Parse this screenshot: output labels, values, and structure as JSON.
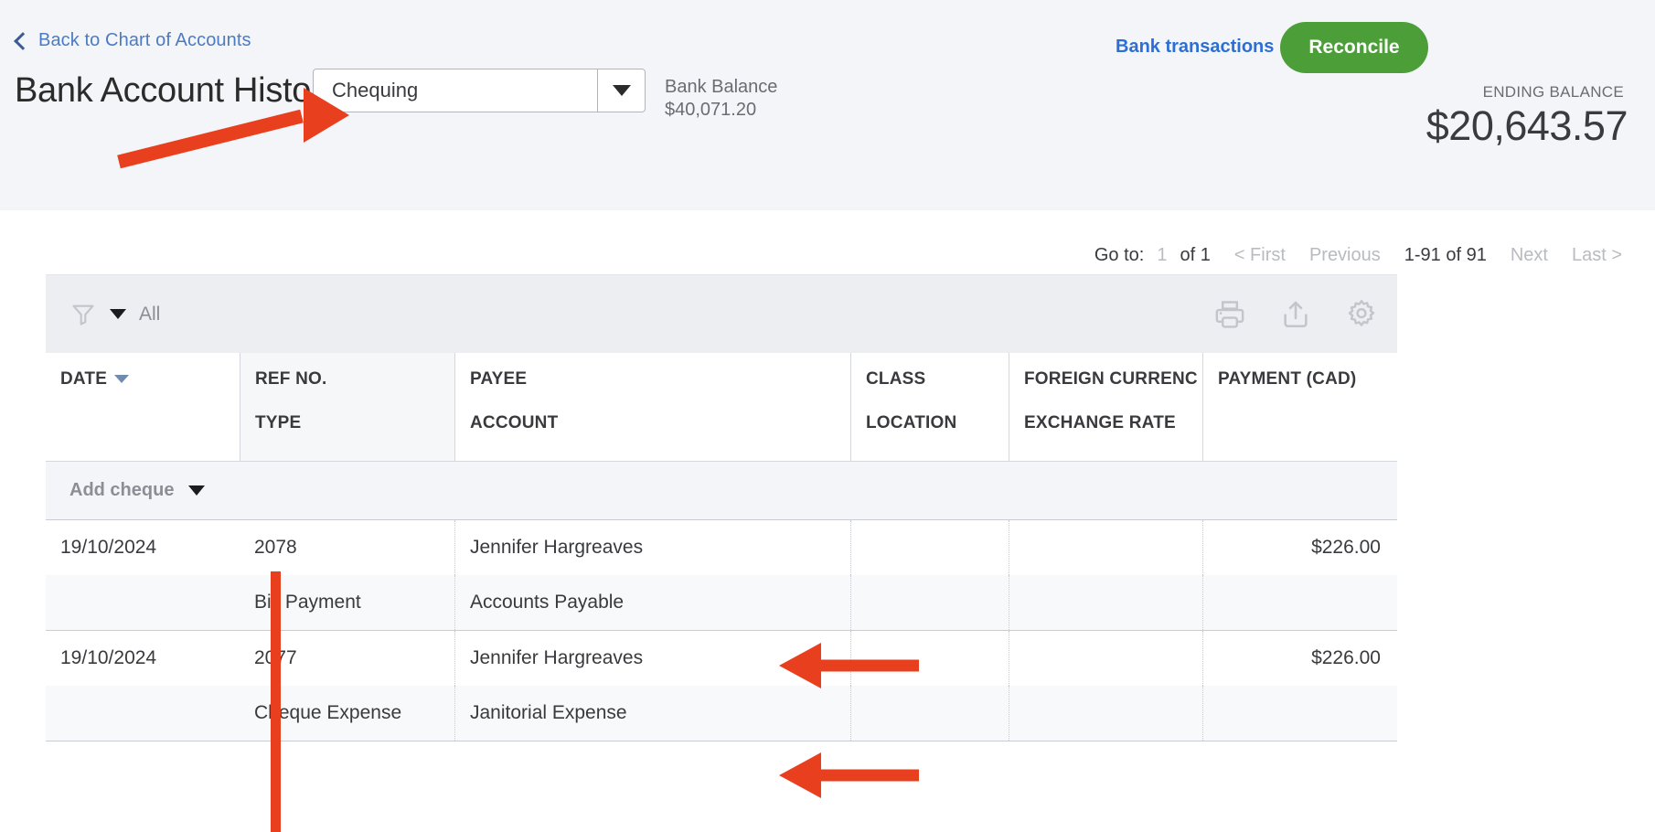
{
  "header": {
    "back_link": "Back to Chart of Accounts",
    "back_icon": "chevron-left-icon",
    "title": "Bank Account History",
    "account_select": {
      "value": "Chequing",
      "caret_icon": "chevron-down-icon"
    },
    "bank_balance_label": "Bank Balance",
    "bank_balance_amount": "$40,071.20",
    "bank_transactions_link": "Bank transactions",
    "reconcile_button": "Reconcile",
    "ending_balance_label": "ENDING BALANCE",
    "ending_balance_amount": "$20,643.57",
    "accent_green": "#4c9f38",
    "accent_blue": "#2b6fd4",
    "bg": "#f4f5f8"
  },
  "pagination": {
    "goto_label": "Go to:",
    "page_number": "1",
    "of_pages": "of 1",
    "first": "< First",
    "previous": "Previous",
    "range": "1-91 of 91",
    "next": "Next",
    "last": "Last >"
  },
  "toolbar": {
    "filter_icon": "funnel-icon",
    "filter_caret": "caret-down-icon",
    "filter_label": "All",
    "print_icon": "printer-icon",
    "export_icon": "export-upload-icon",
    "settings_icon": "gear-icon"
  },
  "table": {
    "columns": [
      {
        "line1": "DATE",
        "line2": "",
        "sorted": true
      },
      {
        "line1": "REF NO.",
        "line2": "TYPE",
        "sorted": false
      },
      {
        "line1": "PAYEE",
        "line2": "ACCOUNT",
        "sorted": false
      },
      {
        "line1": "CLASS",
        "line2": "LOCATION",
        "sorted": false
      },
      {
        "line1": "FOREIGN CURRENC",
        "line2": "EXCHANGE RATE",
        "sorted": false
      },
      {
        "line1": "PAYMENT (CAD)",
        "line2": "",
        "sorted": false
      }
    ],
    "add_row": {
      "label": "Add cheque",
      "caret_icon": "caret-down-icon"
    },
    "rows": [
      {
        "date": "19/10/2024",
        "ref_no": "2078",
        "type": "Bill Payment",
        "payee": "Jennifer Hargreaves",
        "account": "Accounts Payable",
        "class": "",
        "location": "",
        "foreign_currency": "",
        "exchange_rate": "",
        "payment": "$226.00"
      },
      {
        "date": "19/10/2024",
        "ref_no": "2077",
        "type": "Cheque Expense",
        "payee": "Jennifer Hargreaves",
        "account": "Janitorial Expense",
        "class": "",
        "location": "",
        "foreign_currency": "",
        "exchange_rate": "",
        "payment": "$226.00"
      }
    ]
  },
  "annotations": {
    "color": "#e8401f",
    "items": [
      {
        "name": "arrow-to-account-select",
        "type": "arrow-up-right"
      },
      {
        "name": "arrow-to-accounts-payable",
        "type": "arrow-left"
      },
      {
        "name": "arrow-to-janitorial-expense",
        "type": "arrow-left"
      },
      {
        "name": "ref-no-column-highlight-bar",
        "type": "vertical-bar"
      }
    ]
  }
}
